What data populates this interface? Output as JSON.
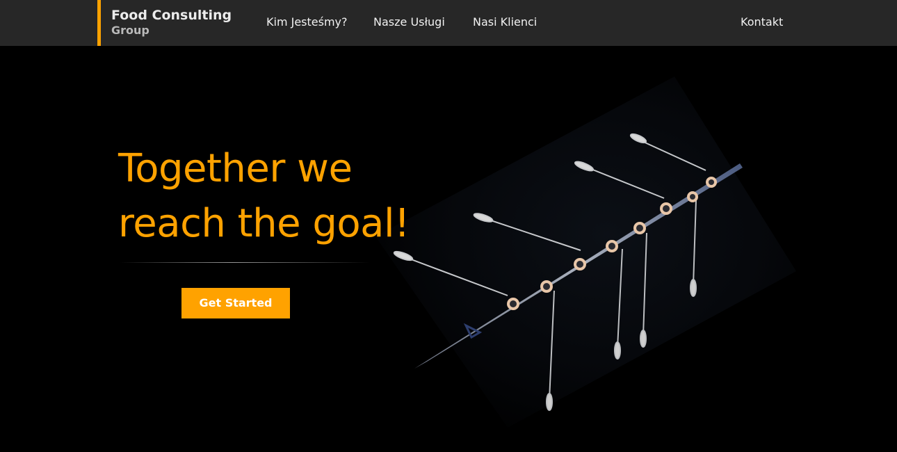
{
  "header": {
    "brand": {
      "line1": "Food Consulting",
      "line2": "Group"
    },
    "nav": [
      {
        "label": "Kim Jesteśmy?"
      },
      {
        "label": "Nasze Usługi"
      },
      {
        "label": "Nasi Klienci"
      },
      {
        "label": "Kontakt"
      }
    ]
  },
  "hero": {
    "title_line1": "Together we",
    "title_line2": "reach the goal!",
    "cta_label": "Get Started",
    "image": "rowing-boat-aerial-photo"
  },
  "colors": {
    "accent": "#ffa200",
    "nav_background": "#272727",
    "page_background": "#000000"
  }
}
